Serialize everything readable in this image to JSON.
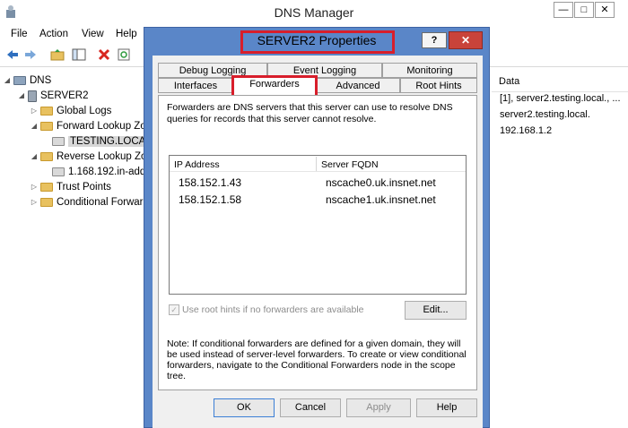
{
  "window": {
    "title": "DNS Manager",
    "minimize_glyph": "—",
    "maximize_glyph": "□",
    "close_glyph": "✕"
  },
  "menu": [
    "File",
    "Action",
    "View",
    "Help"
  ],
  "toolbar_icons": [
    "back-arrow-icon",
    "forward-arrow-icon",
    "folder-up-icon",
    "show-hide-tree-icon",
    "delete-icon",
    "refresh-icon"
  ],
  "tree": {
    "root": "DNS",
    "server": "SERVER2",
    "items": {
      "global_logs": "Global Logs",
      "forward_zones": "Forward Lookup Zo",
      "testing_local": "TESTING.LOCAL",
      "reverse_zones": "Reverse Lookup Zo",
      "reverse_child": "1.168.192.in-add",
      "trust_points": "Trust Points",
      "conditional": "Conditional Forwar"
    }
  },
  "right_pane": {
    "header": "Data",
    "rows": [
      "[1], server2.testing.local., ...",
      "server2.testing.local.",
      "192.168.1.2"
    ]
  },
  "dialog": {
    "title": "SERVER2 Properties",
    "help_glyph": "?",
    "close_glyph": "✕",
    "tabs_top": [
      "Debug Logging",
      "Event Logging",
      "Monitoring"
    ],
    "tabs_bottom": [
      "Interfaces",
      "Forwarders",
      "Advanced",
      "Root Hints"
    ],
    "description": "Forwarders are DNS servers that this server can use to resolve DNS queries for records that this server cannot resolve.",
    "columns": [
      "IP Address",
      "Server FQDN"
    ],
    "forwarders": [
      {
        "ip": "158.152.1.43",
        "fqdn": "nscache0.uk.insnet.net"
      },
      {
        "ip": "158.152.1.58",
        "fqdn": "nscache1.uk.insnet.net"
      }
    ],
    "use_root_hints_label": "Use root hints if no forwarders are available",
    "use_root_hints_checked": true,
    "edit_button": "Edit...",
    "note": "Note: If conditional forwarders are defined for a given domain, they will be used instead of server-level forwarders.  To create or view conditional forwarders, navigate to the Conditional Forwarders node in the scope tree.",
    "buttons": {
      "ok": "OK",
      "cancel": "Cancel",
      "apply": "Apply",
      "help": "Help"
    }
  },
  "colors": {
    "dialog_frame": "#5a86c8",
    "highlight": "#d81e2b",
    "close_button": "#c9433a"
  }
}
